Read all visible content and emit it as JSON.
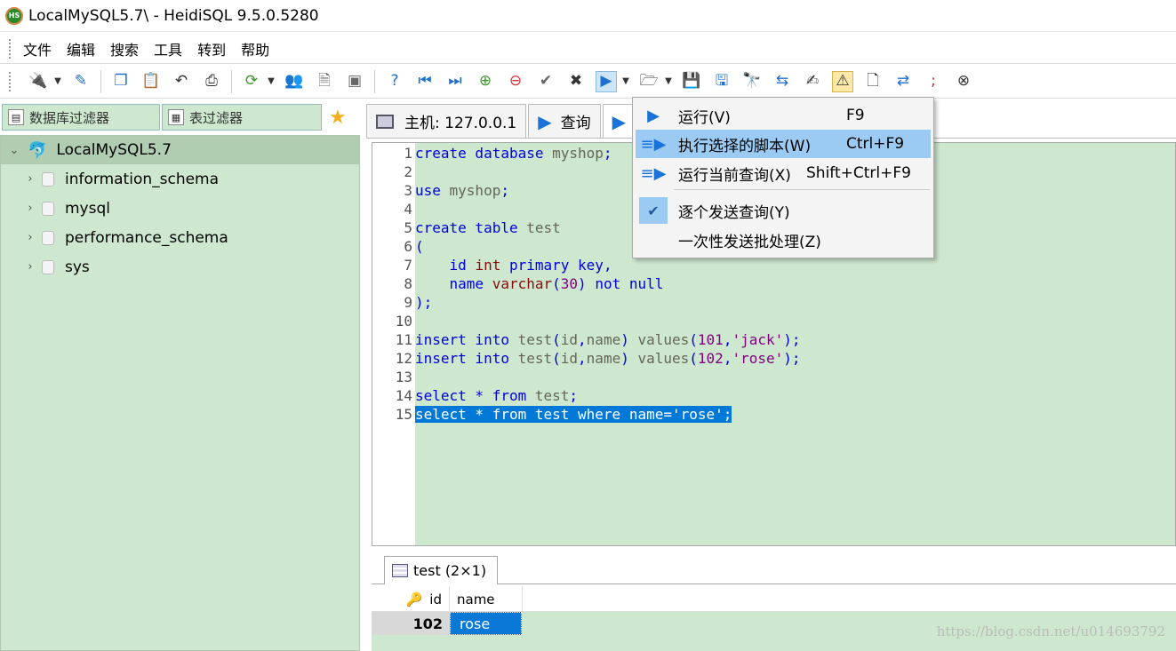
{
  "window": {
    "title": "LocalMySQL5.7\\ - HeidiSQL 9.5.0.5280",
    "logo_text": "HS"
  },
  "menubar": {
    "items": [
      "文件",
      "编辑",
      "搜索",
      "工具",
      "转到",
      "帮助"
    ]
  },
  "toolbar": {
    "icons": [
      "connect-icon",
      "disconnect-icon",
      "copy-icon",
      "paste-icon",
      "undo-icon",
      "print-icon",
      "refresh-icon",
      "user-manager-icon",
      "export-icon",
      "import-icon",
      "help-icon",
      "first-icon",
      "last-icon",
      "add-icon",
      "delete-icon",
      "post-icon",
      "cancel-icon",
      "run-icon",
      "open-file-icon",
      "save-icon",
      "save-as-icon",
      "find-icon",
      "replace-icon",
      "edit-icon",
      "warning-icon",
      "hex-icon",
      "wrap-icon",
      "semicolon-icon",
      "stop-icon"
    ]
  },
  "left_panel": {
    "tabs": [
      {
        "label": "数据库过滤器"
      },
      {
        "label": "表过滤器"
      }
    ],
    "tree": {
      "root": "LocalMySQL5.7",
      "databases": [
        "information_schema",
        "mysql",
        "performance_schema",
        "sys"
      ]
    }
  },
  "right_tabs": [
    {
      "label": "主机: 127.0.0.1"
    },
    {
      "label": "查询"
    }
  ],
  "editor": {
    "line_numbers": [
      "1",
      "2",
      "3",
      "4",
      "5",
      "6",
      "7",
      "8",
      "9",
      "10",
      "11",
      "12",
      "13",
      "14",
      "15"
    ],
    "lines": [
      [
        {
          "t": "create database ",
          "c": "kw"
        },
        {
          "t": "myshop",
          "c": "ident"
        },
        {
          "t": ";",
          "c": "kw"
        }
      ],
      [],
      [
        {
          "t": "use ",
          "c": "kw"
        },
        {
          "t": "myshop",
          "c": "ident"
        },
        {
          "t": ";",
          "c": "kw"
        }
      ],
      [],
      [
        {
          "t": "create table ",
          "c": "kw"
        },
        {
          "t": "test",
          "c": "ident"
        }
      ],
      [
        {
          "t": "(",
          "c": "kw"
        }
      ],
      [
        {
          "t": "    id ",
          "c": "kw"
        },
        {
          "t": "int",
          "c": "kw2"
        },
        {
          "t": " primary key,",
          "c": "kw"
        }
      ],
      [
        {
          "t": "    name ",
          "c": "kw"
        },
        {
          "t": "varchar",
          "c": "kw2"
        },
        {
          "t": "(",
          "c": "kw"
        },
        {
          "t": "30",
          "c": "num"
        },
        {
          "t": ") not null",
          "c": "kw"
        }
      ],
      [
        {
          "t": ");",
          "c": "kw"
        }
      ],
      [],
      [
        {
          "t": "insert into ",
          "c": "kw"
        },
        {
          "t": "test",
          "c": "ident"
        },
        {
          "t": "(",
          "c": "kw"
        },
        {
          "t": "id",
          "c": "ident"
        },
        {
          "t": ",",
          "c": "kw"
        },
        {
          "t": "name",
          "c": "ident"
        },
        {
          "t": ") ",
          "c": "kw"
        },
        {
          "t": "values",
          "c": "ident"
        },
        {
          "t": "(",
          "c": "kw"
        },
        {
          "t": "101",
          "c": "num"
        },
        {
          "t": ",",
          "c": "kw"
        },
        {
          "t": "'jack'",
          "c": "str"
        },
        {
          "t": ");",
          "c": "kw"
        }
      ],
      [
        {
          "t": "insert into ",
          "c": "kw"
        },
        {
          "t": "test",
          "c": "ident"
        },
        {
          "t": "(",
          "c": "kw"
        },
        {
          "t": "id",
          "c": "ident"
        },
        {
          "t": ",",
          "c": "kw"
        },
        {
          "t": "name",
          "c": "ident"
        },
        {
          "t": ") ",
          "c": "kw"
        },
        {
          "t": "values",
          "c": "ident"
        },
        {
          "t": "(",
          "c": "kw"
        },
        {
          "t": "102",
          "c": "num"
        },
        {
          "t": ",",
          "c": "kw"
        },
        {
          "t": "'rose'",
          "c": "str"
        },
        {
          "t": ");",
          "c": "kw"
        }
      ],
      [],
      [
        {
          "t": "select * from ",
          "c": "kw"
        },
        {
          "t": "test",
          "c": "ident"
        },
        {
          "t": ";",
          "c": "kw"
        }
      ],
      [
        {
          "t": "select * from test where name='rose';",
          "c": "sel"
        }
      ]
    ]
  },
  "dropdown": {
    "items": [
      {
        "label": "运行(V)",
        "shortcut": "F9",
        "icon": "play-icon"
      },
      {
        "label": "执行选择的脚本(W)",
        "shortcut": "Ctrl+F9",
        "icon": "run-selection-icon",
        "hover": true
      },
      {
        "label": "运行当前查询(X)",
        "shortcut": "Shift+Ctrl+F9",
        "icon": "run-current-icon"
      },
      {
        "label": "逐个发送查询(Y)",
        "shortcut": "",
        "icon": "check-icon",
        "checked": true
      },
      {
        "label": "一次性发送批处理(Z)",
        "shortcut": "",
        "icon": ""
      }
    ]
  },
  "result": {
    "tab_label": "test (2×1)",
    "columns": [
      "id",
      "name"
    ],
    "rows": [
      {
        "id": "102",
        "name": "rose"
      }
    ]
  },
  "watermark": "https://blog.csdn.net/u014693792",
  "colors": {
    "editor_bg": "#cde8cf",
    "selection": "#0078d7",
    "keyword": "#0000e0",
    "menu_hover": "#9bcbf3"
  }
}
